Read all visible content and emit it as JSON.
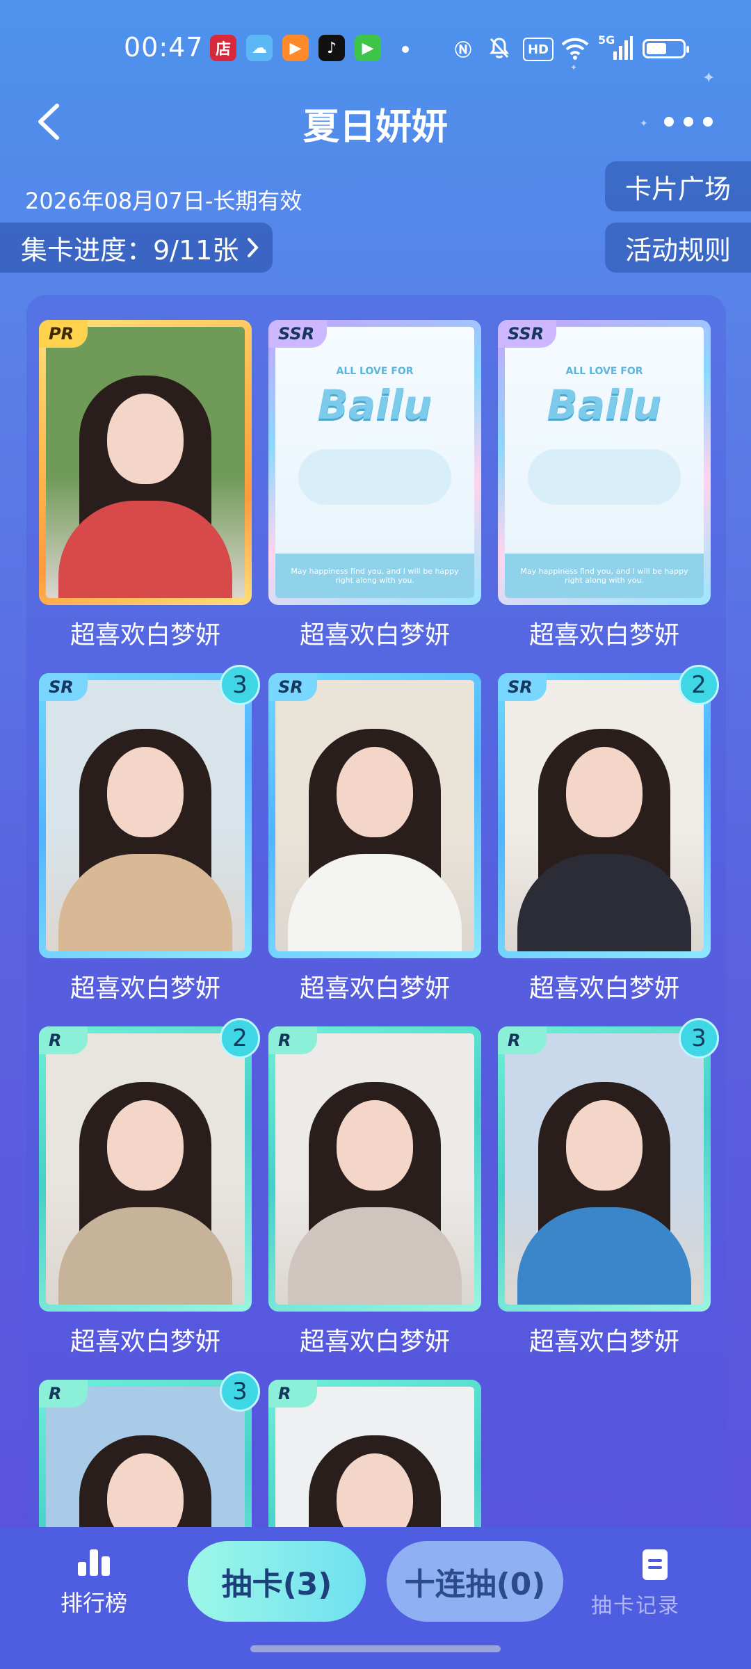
{
  "status_bar": {
    "time": "00:47",
    "app_icons": [
      {
        "name": "shop-app-icon",
        "label": "店",
        "color": "#d8283c"
      },
      {
        "name": "weather-app-icon",
        "label": "",
        "color": "#5bb8f5"
      },
      {
        "name": "video-app-icon",
        "label": "",
        "color": "#ff8a2a"
      },
      {
        "name": "tiktok-app-icon",
        "label": "",
        "color": "#111111"
      },
      {
        "name": "iqiyi-app-icon",
        "label": "",
        "color": "#3fc44a"
      }
    ],
    "hd_label": "HD",
    "network_label": "5G",
    "battery_level": 0.55
  },
  "header": {
    "title": "夏日妍妍",
    "validity": "2026年08月07日-长期有效",
    "progress_label": "集卡进度：9/11张",
    "card_plaza_button": "卡片广场",
    "rules_button": "活动规则"
  },
  "cards": [
    {
      "rarity": "PR",
      "caption": "超喜欢白梦妍",
      "count": "",
      "art": "photo",
      "top": "#6f9a58",
      "body": "#d84a4a"
    },
    {
      "rarity": "SSR",
      "caption": "超喜欢白梦妍",
      "count": "",
      "art": "bailu"
    },
    {
      "rarity": "SSR",
      "caption": "超喜欢白梦妍",
      "count": "",
      "art": "bailu"
    },
    {
      "rarity": "SR",
      "caption": "超喜欢白梦妍",
      "count": "3",
      "art": "photo",
      "top": "#d8e4ea",
      "body": "#d9b896"
    },
    {
      "rarity": "SR",
      "caption": "超喜欢白梦妍",
      "count": "",
      "art": "photo",
      "top": "#e9e3d8",
      "body": "#f4f4f2"
    },
    {
      "rarity": "SR",
      "caption": "超喜欢白梦妍",
      "count": "2",
      "art": "photo",
      "top": "#f0ece8",
      "body": "#2b2c36"
    },
    {
      "rarity": "R",
      "caption": "超喜欢白梦妍",
      "count": "2",
      "art": "photo",
      "top": "#e8e4de",
      "body": "#c7b29a"
    },
    {
      "rarity": "R",
      "caption": "超喜欢白梦妍",
      "count": "",
      "art": "photo",
      "top": "#ecebea",
      "body": "#cfc4be"
    },
    {
      "rarity": "R",
      "caption": "超喜欢白梦妍",
      "count": "3",
      "art": "photo",
      "top": "#c9d8ea",
      "body": "#3a86c8"
    },
    {
      "rarity": "R",
      "caption": "",
      "count": "3",
      "art": "photo",
      "top": "#a9cbe8",
      "body": "#e8ddd8"
    },
    {
      "rarity": "R",
      "caption": "",
      "count": "",
      "art": "photo",
      "top": "#eef0f2",
      "body": "#f2ecec"
    }
  ],
  "bailu_art": {
    "small_text": "ALL LOVE FOR",
    "logo": "Bailu",
    "band_text": "May happiness find you, and I will be happy right along with you."
  },
  "bottom_bar": {
    "ranking_label": "排行榜",
    "draw_button": "抽卡(3)",
    "ten_draw_button": "十连抽(0)",
    "record_label": "抽卡记录"
  }
}
